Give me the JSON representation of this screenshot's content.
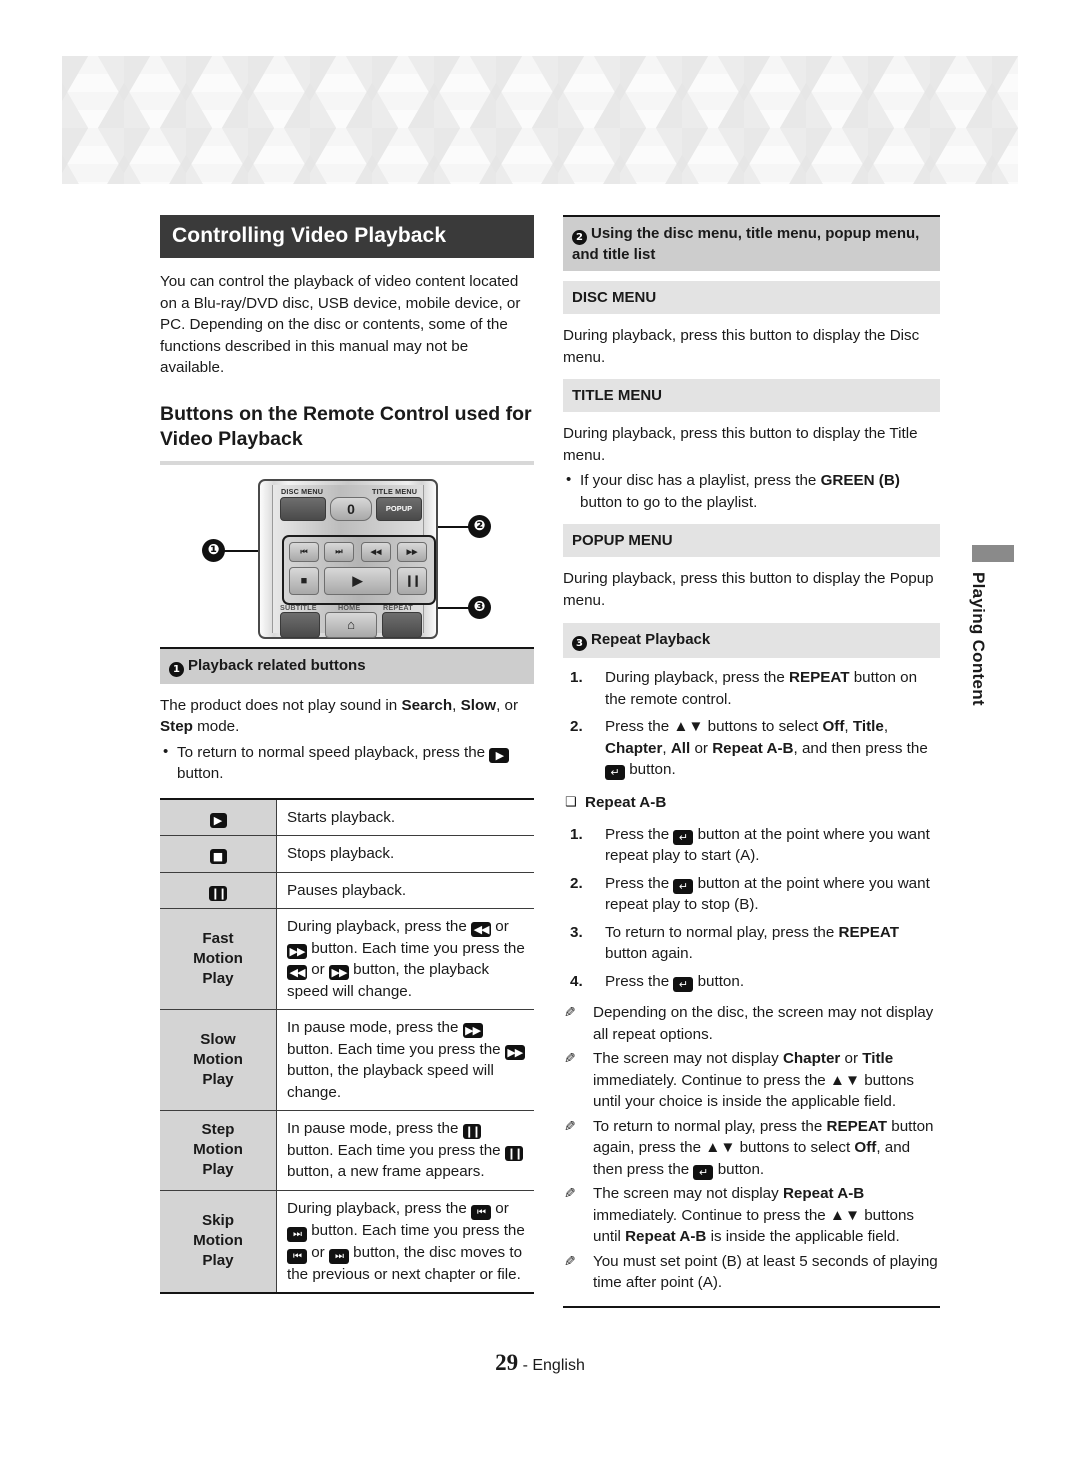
{
  "document": {
    "footer_page": "29",
    "footer_sep": " - ",
    "footer_lang": "English",
    "side_tab": "Playing Content"
  },
  "left": {
    "title": "Controlling Video Playback",
    "intro": "You can control the playback of video content located on a Blu-ray/DVD disc, USB device, mobile device, or PC. Depending on the disc or contents, some of the functions described in this manual may not be available.",
    "subtitle": "Buttons on the Remote Control used for Video Playback",
    "remote": {
      "labels": {
        "disc_menu": "DISC MENU",
        "title_menu": "TITLE MENU",
        "popup": "POPUP",
        "zero": "0",
        "subtitle": "SUBTITLE",
        "home": "HOME",
        "repeat": "REPEAT",
        "home_icon": "⌂",
        "prev": "⏮",
        "next": "⏭",
        "rew": "◀◀",
        "ff": "▶▶",
        "stop": "■",
        "play": "▶",
        "pause": "❙❙"
      },
      "markers": {
        "one": "❶",
        "two": "❷",
        "three": "❸"
      }
    },
    "section1": {
      "marker": "❶",
      "heading": "Playback related buttons",
      "para_a": "The product does not play sound in ",
      "para_b": "Search",
      "para_c": ", ",
      "para_d": "Slow",
      "para_e": ", or ",
      "para_f": "Step",
      "para_g": " mode.",
      "bullet_a": "To return to normal speed playback, press the ",
      "bullet_icon": "▶",
      "bullet_b": " button."
    },
    "table": {
      "rows": [
        {
          "key": "▶",
          "key_type": "glyph",
          "desc": "Starts playback."
        },
        {
          "key": "■",
          "key_type": "glyph",
          "desc": "Stops playback."
        },
        {
          "key": "❙❙",
          "key_type": "glyph",
          "desc": "Pauses playback."
        },
        {
          "key": "Fast\nMotion\nPlay",
          "key_type": "text",
          "key_lines": [
            "Fast",
            "Motion",
            "Play"
          ],
          "desc_parts": [
            "During playback, press the ",
            "◀◀",
            " or ",
            "▶▶",
            " button. Each time you press the ",
            "◀◀",
            " or ",
            "▶▶",
            " button, the playback speed will change."
          ]
        },
        {
          "key": "Slow\nMotion\nPlay",
          "key_type": "text",
          "key_lines": [
            "Slow",
            "Motion",
            "Play"
          ],
          "desc_parts": [
            "In pause mode, press the ",
            "▶▶",
            " button. Each time you press the ",
            "▶▶",
            " button, the playback speed will change."
          ]
        },
        {
          "key": "Step\nMotion\nPlay",
          "key_type": "text",
          "key_lines": [
            "Step",
            "Motion",
            "Play"
          ],
          "desc_parts": [
            "In pause mode, press the ",
            "❙❙",
            " button. Each time you press the ",
            "❙❙",
            " button, a new frame appears."
          ]
        },
        {
          "key": "Skip\nMotion\nPlay",
          "key_type": "text",
          "key_lines": [
            "Skip",
            "Motion",
            "Play"
          ],
          "desc_parts": [
            "During playback, press the ",
            "⏮",
            " or ",
            "⏭",
            " button. Each time you press the ",
            "⏮",
            " or ",
            "⏭",
            " button, the disc moves to the previous or next chapter or file."
          ]
        }
      ]
    }
  },
  "right": {
    "section2": {
      "marker": "❷",
      "heading": "Using the disc menu, title menu, popup menu, and title list",
      "blocks": [
        {
          "head": "DISC MENU",
          "body": "During playback, press this button to display the Disc menu."
        },
        {
          "head": "TITLE MENU",
          "body": "During playback, press this button to display the Title menu.",
          "bullet_a": "If your disc has a playlist, press the ",
          "bullet_bold": "GREEN (B)",
          "bullet_b": " button to go to the playlist."
        },
        {
          "head": "POPUP MENU",
          "body": "During playback, press this button to display the Popup menu."
        }
      ]
    },
    "section3": {
      "marker": "❸",
      "heading": "Repeat Playback",
      "steps": [
        {
          "n": "1.",
          "parts": [
            "During playback, press the ",
            "REPEAT",
            " button on the remote control."
          ]
        },
        {
          "n": "2.",
          "parts": [
            "Press the ▲▼ buttons to select ",
            "Off",
            ", ",
            "Title",
            ", ",
            "Chapter",
            ", ",
            "All",
            " or ",
            "Repeat A-B",
            ", and then press the ",
            "[ENTER]",
            " button."
          ]
        }
      ],
      "sub_heading": "Repeat A-B",
      "ab_steps": [
        {
          "n": "1.",
          "parts": [
            "Press the ",
            "[ENTER]",
            " button at the point where you want repeat play to start (A)."
          ]
        },
        {
          "n": "2.",
          "parts": [
            "Press the ",
            "[ENTER]",
            " button at the point where you want repeat play to stop (B)."
          ]
        },
        {
          "n": "3.",
          "parts": [
            "To return to normal play, press the ",
            "REPEAT",
            " button again."
          ]
        },
        {
          "n": "4.",
          "parts": [
            "Press the ",
            "[ENTER]",
            " button."
          ]
        }
      ],
      "notes": [
        "Depending on the disc, the screen may not display all repeat options.",
        "The screen may not display Chapter or Title immediately. Continue to press the ▲▼ buttons until your choice is inside the applicable field.",
        "To return to normal play, press the REPEAT button again, press the ▲▼ buttons to select Off, and then press the [ENTER] button.",
        "The screen may not display Repeat A-B immediately. Continue to press the ▲▼ buttons until Repeat A-B is inside the applicable field.",
        "You must set point (B) at least 5 seconds of playing time after point (A)."
      ],
      "note_icon": "✎"
    }
  }
}
